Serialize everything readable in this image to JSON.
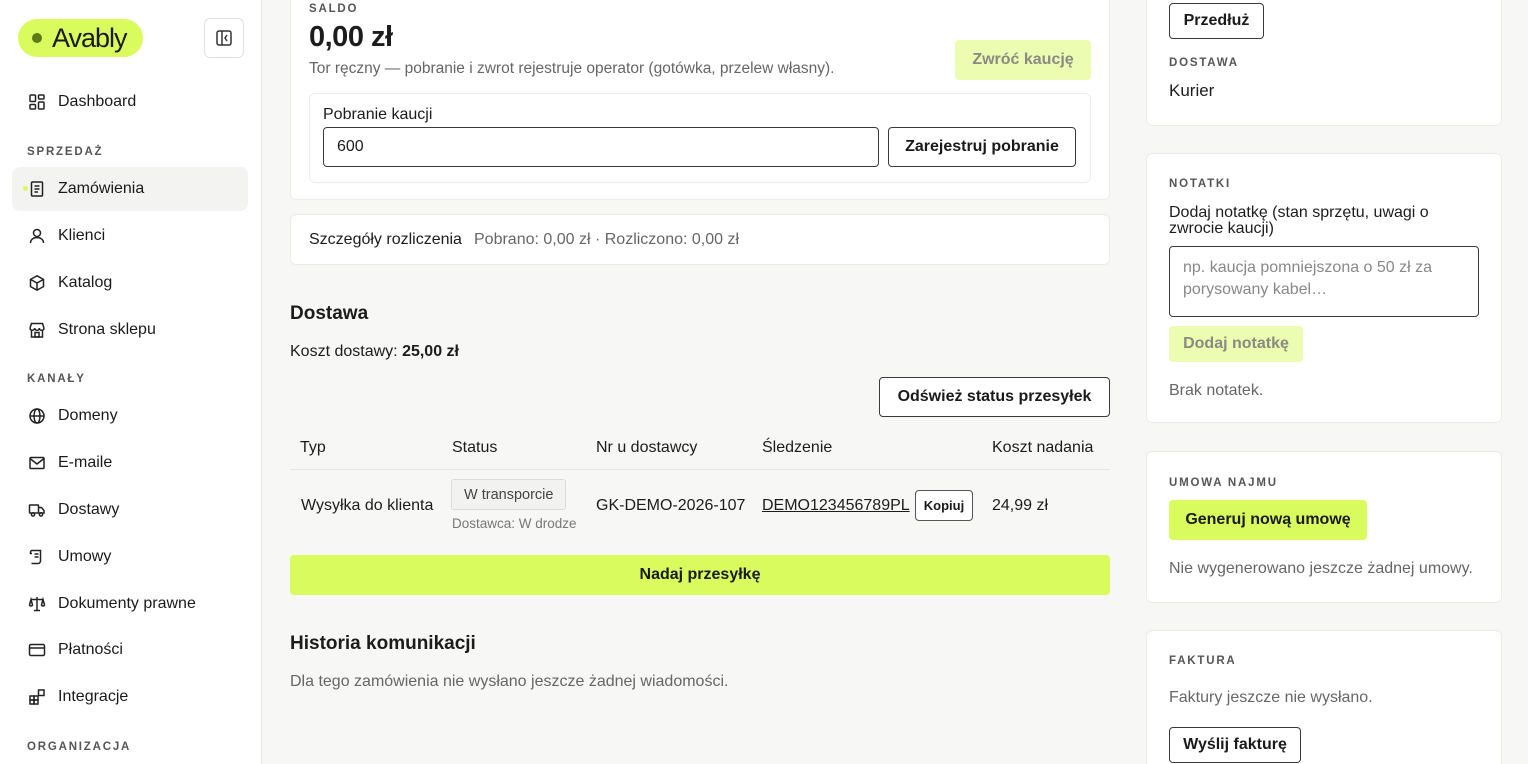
{
  "brand": {
    "name": "Avably"
  },
  "sidebar": {
    "sections": {
      "sales": "SPRZEDAŻ",
      "channels": "KANAŁY",
      "organization": "ORGANIZACJA"
    },
    "items": [
      {
        "label": "Dashboard",
        "icon": "dashboard-icon"
      },
      {
        "label": "Zamówienia",
        "icon": "orders-icon"
      },
      {
        "label": "Klienci",
        "icon": "customers-icon"
      },
      {
        "label": "Katalog",
        "icon": "catalog-icon"
      },
      {
        "label": "Strona sklepu",
        "icon": "storefront-icon"
      },
      {
        "label": "Domeny",
        "icon": "globe-icon"
      },
      {
        "label": "E-maile",
        "icon": "mail-icon"
      },
      {
        "label": "Dostawy",
        "icon": "truck-icon"
      },
      {
        "label": "Umowy",
        "icon": "contract-icon"
      },
      {
        "label": "Dokumenty prawne",
        "icon": "scale-icon"
      },
      {
        "label": "Płatności",
        "icon": "card-icon"
      },
      {
        "label": "Integracje",
        "icon": "integrations-icon"
      }
    ]
  },
  "deposit": {
    "section_label": "SALDO",
    "balance": "0,00 zł",
    "description": "Tor ręczny — pobranie i zwrot rejestruje operator (gotówka, przelew własny).",
    "return_button": "Zwróć kaucję",
    "collect_label": "Pobranie kaucji",
    "collect_value": "600",
    "register_button": "Zarejestruj pobranie"
  },
  "settlement": {
    "title": "Szczegóły rozliczenia",
    "summary": "Pobrano: 0,00 zł · Rozliczono: 0,00 zł"
  },
  "delivery": {
    "title": "Dostawa",
    "cost_label": "Koszt dostawy:",
    "cost_value": "25,00 zł",
    "refresh_button": "Odśwież status przesyłek",
    "columns": [
      "Typ",
      "Status",
      "Nr u dostawcy",
      "Śledzenie",
      "Koszt nadania"
    ],
    "row": {
      "type": "Wysyłka do klienta",
      "status": "W transporcie",
      "status_sub": "Dostawca: W drodze",
      "carrier_no": "GK-DEMO-2026-107",
      "tracking": "DEMO123456789PL",
      "copy_button": "Kopiuj",
      "cost": "24,99 zł"
    },
    "ship_button": "Nadaj przesyłkę"
  },
  "history": {
    "title": "Historia komunikacji",
    "empty": "Dla tego zamówienia nie wysłano jeszcze żadnej wiadomości."
  },
  "right": {
    "extend_button": "Przedłuż",
    "delivery_label": "DOSTAWA",
    "delivery_value": "Kurier",
    "notes_label": "NOTATKI",
    "notes_field_label": "Dodaj notatkę (stan sprzętu, uwagi o zwrocie kaucji)",
    "notes_placeholder": "np. kaucja pomniejszona o 50 zł za porysowany kabel…",
    "add_note_button": "Dodaj notatkę",
    "notes_empty": "Brak notatek.",
    "contract_label": "UMOWA NAJMU",
    "contract_button": "Generuj nową umowę",
    "contract_empty": "Nie wygenerowano jeszcze żadnej umowy.",
    "invoice_label": "FAKTURA",
    "invoice_empty": "Faktury jeszcze nie wysłano.",
    "invoice_button": "Wyślij fakturę"
  },
  "colors": {
    "accent": "#d9fb5d",
    "accent_dim": "#ecfcb0"
  }
}
